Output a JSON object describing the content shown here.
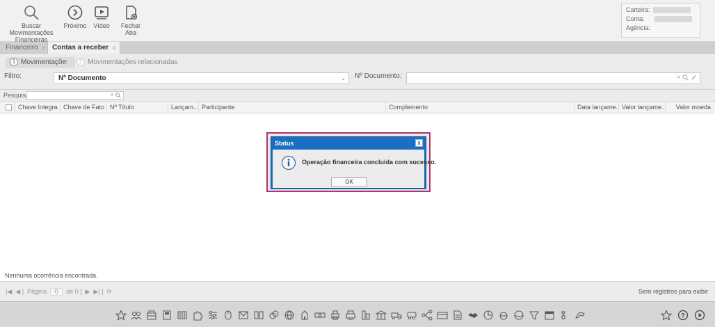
{
  "toolbar": {
    "buttons": [
      {
        "label_line1": "Buscar Movimentações",
        "label_line2": "Financeiras",
        "icon": "search-icon"
      },
      {
        "label_line1": "Próximo",
        "label_line2": "",
        "icon": "next-circle-icon"
      },
      {
        "label_line1": "Vídeo",
        "label_line2": "",
        "icon": "video-play-icon"
      },
      {
        "label_line1": "Fechar Aba",
        "label_line2": "",
        "icon": "close-tab-icon"
      }
    ],
    "info": {
      "carteira_label": "Carteira:",
      "conta_label": "Conta:",
      "agencia_label": "Agência:"
    }
  },
  "tabs": [
    {
      "label": "Financeiro",
      "close": "x",
      "active": false
    },
    {
      "label": "Contas a receber",
      "close": "x",
      "active": true
    }
  ],
  "steps": [
    {
      "num": "1",
      "label": "Movimentações"
    },
    {
      "num": "2",
      "label": "Movimentações relacionadas"
    }
  ],
  "filter": {
    "label": "Filtro:",
    "selected": "Nº Documento",
    "field_label": "Nº Documento:",
    "field_value": ""
  },
  "grid": {
    "search_label": "Pesquisar",
    "search_value": "",
    "columns": [
      "Chave Integra...",
      "Chave de Fato",
      "Nº Título",
      "Lançam...",
      "Participante",
      "Complemento",
      "Data lançame...",
      "Valor lançame...",
      "Valor moeda"
    ],
    "rows": []
  },
  "status_text": "Nenhuma ocorrência encontrada.",
  "pager": {
    "page_label": "Página",
    "page_value": "0",
    "of_label": "de 0",
    "right_text": "Sem registros para exibir"
  },
  "modal": {
    "title": "Status",
    "close": "x",
    "message": "Operação financeira concluída com sucesso.",
    "ok_label": "OK"
  },
  "dock_icon_names": [
    "star-icon",
    "people-icon",
    "cash-register-icon",
    "calculator-icon",
    "barcode-icon",
    "puzzle-icon",
    "settings-sliders-icon",
    "mouse-icon",
    "envelope-icon",
    "book-icon",
    "coins-icon",
    "globe-icon",
    "building-icon",
    "money-icon",
    "printer-icon",
    "printer-2-icon",
    "building-2-icon",
    "bank-icon",
    "truck-icon",
    "bus-icon",
    "connections-icon",
    "card-icon",
    "document-icon",
    "handshake-icon",
    "pie-icon",
    "pie-2-icon",
    "tags-icon",
    "filter-icon",
    "calendar-icon",
    "puzzle-2-icon",
    "dragon-icon"
  ],
  "colors": {
    "modal_blue": "#1b6ec2",
    "modal_frame": "#b0336e"
  }
}
